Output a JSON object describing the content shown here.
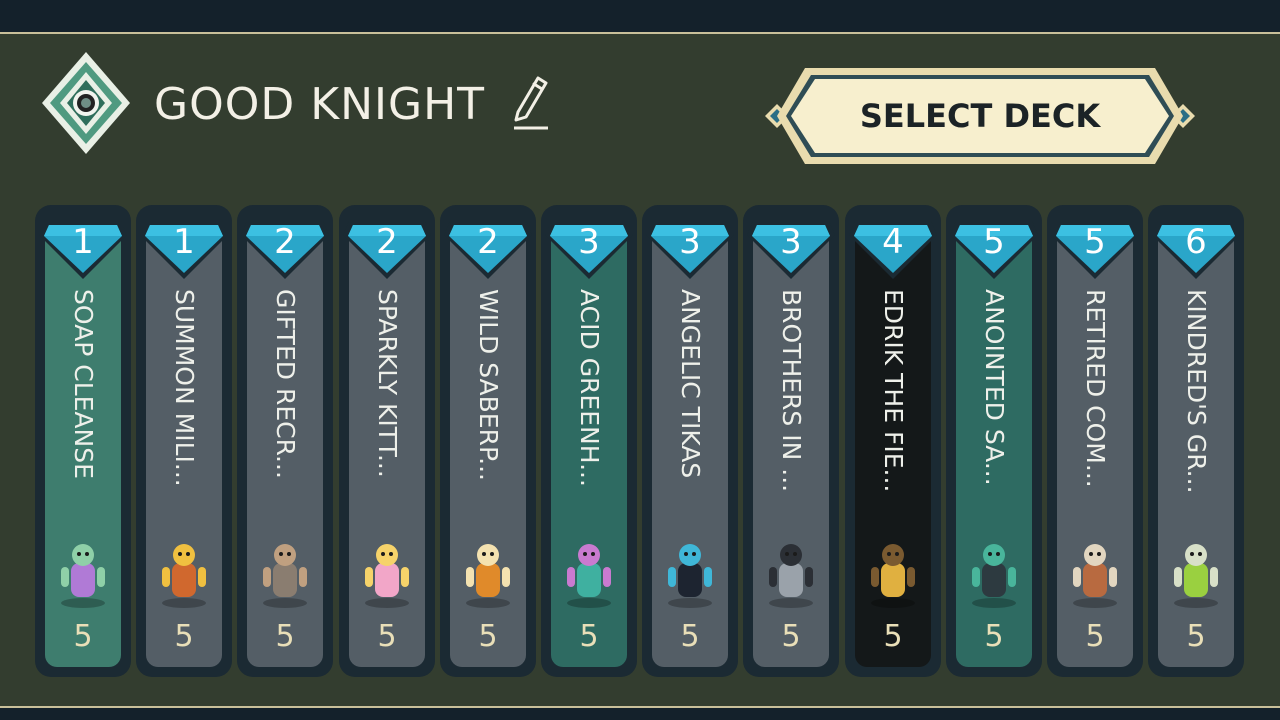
{
  "header": {
    "deck_name": "GOOD KNIGHT",
    "select_deck_label": "SELECT DECK"
  },
  "colors": {
    "background": "#333d2f",
    "frame_trim": "#c9c09a",
    "gem": "#2aa6c9",
    "card_green": "#3e7d6e",
    "card_teal": "#2e6b62",
    "card_gray": "#545e66",
    "card_black": "#141819",
    "button_cream": "#f7efce"
  },
  "cards": [
    {
      "cost": "1",
      "name": "SOAP CLEANSE",
      "count": "5",
      "style": "green",
      "art": "purple-monster-icon"
    },
    {
      "cost": "1",
      "name": "SUMMON MILI...",
      "count": "5",
      "style": "gray",
      "art": "militia-banner-icon"
    },
    {
      "cost": "2",
      "name": "GIFTED RECR...",
      "count": "5",
      "style": "gray",
      "art": "spear-recruit-icon"
    },
    {
      "cost": "2",
      "name": "SPARKLY KITT...",
      "count": "5",
      "style": "gray",
      "art": "pink-kitten-icon"
    },
    {
      "cost": "2",
      "name": "WILD SABERP...",
      "count": "5",
      "style": "gray",
      "art": "saber-cat-icon"
    },
    {
      "cost": "3",
      "name": "ACID GREENH...",
      "count": "5",
      "style": "teal",
      "art": "acid-goblin-icon"
    },
    {
      "cost": "3",
      "name": "ANGELIC TIKAS",
      "count": "5",
      "style": "gray",
      "art": "black-cat-icon"
    },
    {
      "cost": "3",
      "name": "BROTHERS IN ...",
      "count": "5",
      "style": "gray",
      "art": "twin-warriors-icon"
    },
    {
      "cost": "4",
      "name": "EDRIK THE FIE...",
      "count": "5",
      "style": "black",
      "art": "golden-knight-icon"
    },
    {
      "cost": "5",
      "name": "ANOINTED SA...",
      "count": "5",
      "style": "teal",
      "art": "robed-saint-icon"
    },
    {
      "cost": "5",
      "name": "RETIRED COM...",
      "count": "5",
      "style": "gray",
      "art": "old-commander-icon"
    },
    {
      "cost": "6",
      "name": "KINDRED'S GR...",
      "count": "5",
      "style": "gray",
      "art": "green-orb-icon"
    }
  ]
}
